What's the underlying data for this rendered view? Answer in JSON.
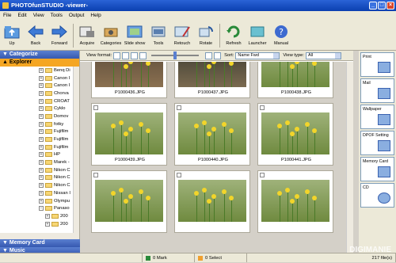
{
  "window": {
    "title": "PHOTOfunSTUDIO -viewer-"
  },
  "menu": [
    "File",
    "Edit",
    "View",
    "Tools",
    "Output",
    "Help"
  ],
  "toolbar": [
    {
      "label": "Up",
      "icon": "up-folder-icon"
    },
    {
      "label": "Back",
      "icon": "back-arrow-icon"
    },
    {
      "label": "Forward",
      "icon": "forward-arrow-icon"
    },
    {
      "label": "Acquire",
      "icon": "acquire-icon"
    },
    {
      "label": "Categories",
      "icon": "categories-icon"
    },
    {
      "label": "Slide show",
      "icon": "slideshow-icon"
    },
    {
      "label": "Tools",
      "icon": "tools-icon"
    },
    {
      "label": "Retouch",
      "icon": "retouch-icon"
    },
    {
      "label": "Rotate",
      "icon": "rotate-icon"
    },
    {
      "label": "Refresh",
      "icon": "refresh-icon"
    },
    {
      "label": "Launcher",
      "icon": "launcher-icon"
    },
    {
      "label": "Manual",
      "icon": "manual-icon"
    }
  ],
  "left": {
    "categorize": "Categorize",
    "explorer": "Explorer",
    "tree": [
      "Benq Di",
      "Canon I",
      "Canon I",
      "Chorva",
      "CROAT",
      "Cyklo",
      "Domov",
      "fotky",
      "Fujifilm",
      "Fujifilm",
      "Fujifilm",
      "HP",
      "Marek -",
      "Nikon C",
      "Nikon C",
      "Nikon C",
      "Nissan I",
      "Olympu",
      "Panaso",
      "200",
      "200"
    ],
    "memory_card": "Memory Card",
    "music": "Music"
  },
  "viewbar": {
    "view_format_label": "View format:",
    "sort_label": "Sort:",
    "sort_value": "Name Fwd",
    "view_type_label": "View type:",
    "view_type_value": "All"
  },
  "thumbnails": [
    {
      "name": "P1000436.JPG"
    },
    {
      "name": "P1000437.JPG"
    },
    {
      "name": "P1000438.JPG"
    },
    {
      "name": "P1000439.JPG"
    },
    {
      "name": "P1000440.JPG"
    },
    {
      "name": "P1000441.JPG"
    },
    {
      "name": ""
    },
    {
      "name": ""
    },
    {
      "name": ""
    }
  ],
  "right_tabs": [
    "Print",
    "Mail",
    "Wallpaper",
    "DPOF Setting",
    "Memory Card",
    "CD"
  ],
  "status": {
    "mark": "0 Mark",
    "select": "0 Select",
    "files": "217 file(s)"
  },
  "watermark": "DIGIMANIE",
  "colors": {
    "title_bar": "#0a3fb0",
    "panel_header": "#3659b0",
    "explorer_header": "#f5a623"
  }
}
